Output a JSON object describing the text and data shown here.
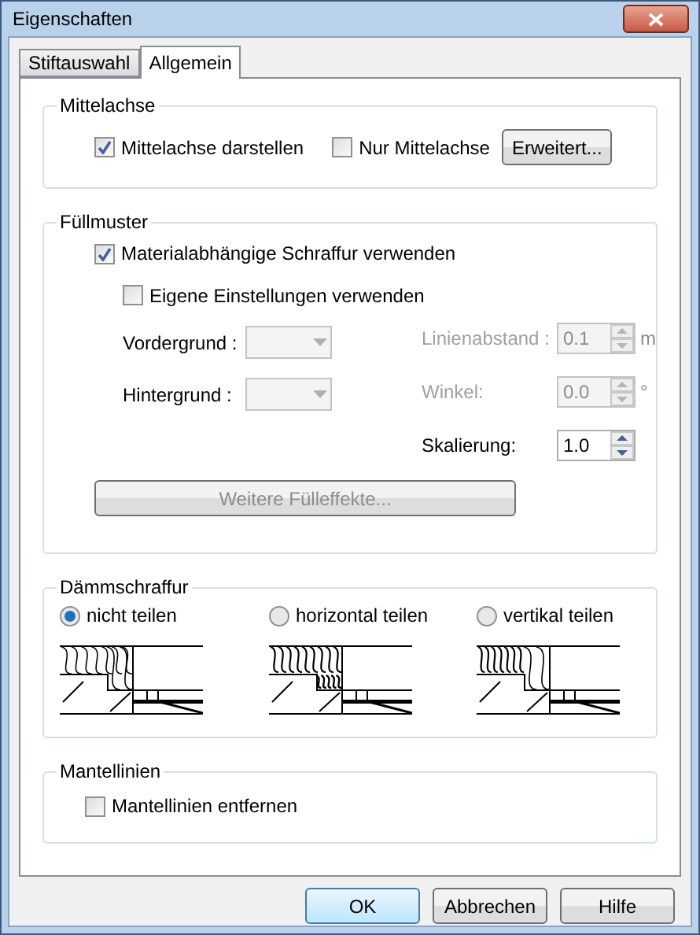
{
  "window": {
    "title": "Eigenschaften"
  },
  "tabs": [
    {
      "label": "Stiftauswahl",
      "selected": false
    },
    {
      "label": "Allgemein",
      "selected": true
    }
  ],
  "mittelachse": {
    "title": "Mittelachse",
    "checkboxes": [
      {
        "label": "Mittelachse darstellen",
        "checked": true
      },
      {
        "label": "Nur Mittelachse",
        "checked": false
      }
    ],
    "button": "Erweitert..."
  },
  "fuellmuster": {
    "title": "Füllmuster",
    "material": {
      "label": "Materialabhängige Schraffur verwenden",
      "checked": true
    },
    "eigene": {
      "label": "Eigene Einstellungen verwenden",
      "checked": false
    },
    "colors": [
      {
        "label": "Vordergrund :",
        "disabled": true
      },
      {
        "label": "Hintergrund :",
        "disabled": true
      }
    ],
    "fields": [
      {
        "label": "Linienabstand :",
        "value": "0.1",
        "unit": "m",
        "disabled": true
      },
      {
        "label": "Winkel:",
        "value": "0.0",
        "unit": "°",
        "disabled": true
      },
      {
        "label": "Skalierung:",
        "value": "1.0",
        "disabled": false
      }
    ],
    "button": {
      "label": "Weitere Fülleffekte...",
      "disabled": true
    }
  },
  "daemmschraffur": {
    "title": "Dämmschraffur",
    "options": [
      {
        "label": "nicht teilen",
        "selected": true,
        "kind": "none"
      },
      {
        "label": "horizontal teilen",
        "selected": false,
        "kind": "horizontal"
      },
      {
        "label": "vertikal teilen",
        "selected": false,
        "kind": "vertical"
      }
    ]
  },
  "mantellinien": {
    "title": "Mantellinien",
    "checkbox": {
      "label": "Mantellinien entfernen",
      "checked": false
    }
  },
  "buttons": [
    {
      "label": "OK",
      "default": true
    },
    {
      "label": "Abbrechen",
      "default": false
    },
    {
      "label": "Hilfe",
      "default": false
    }
  ]
}
